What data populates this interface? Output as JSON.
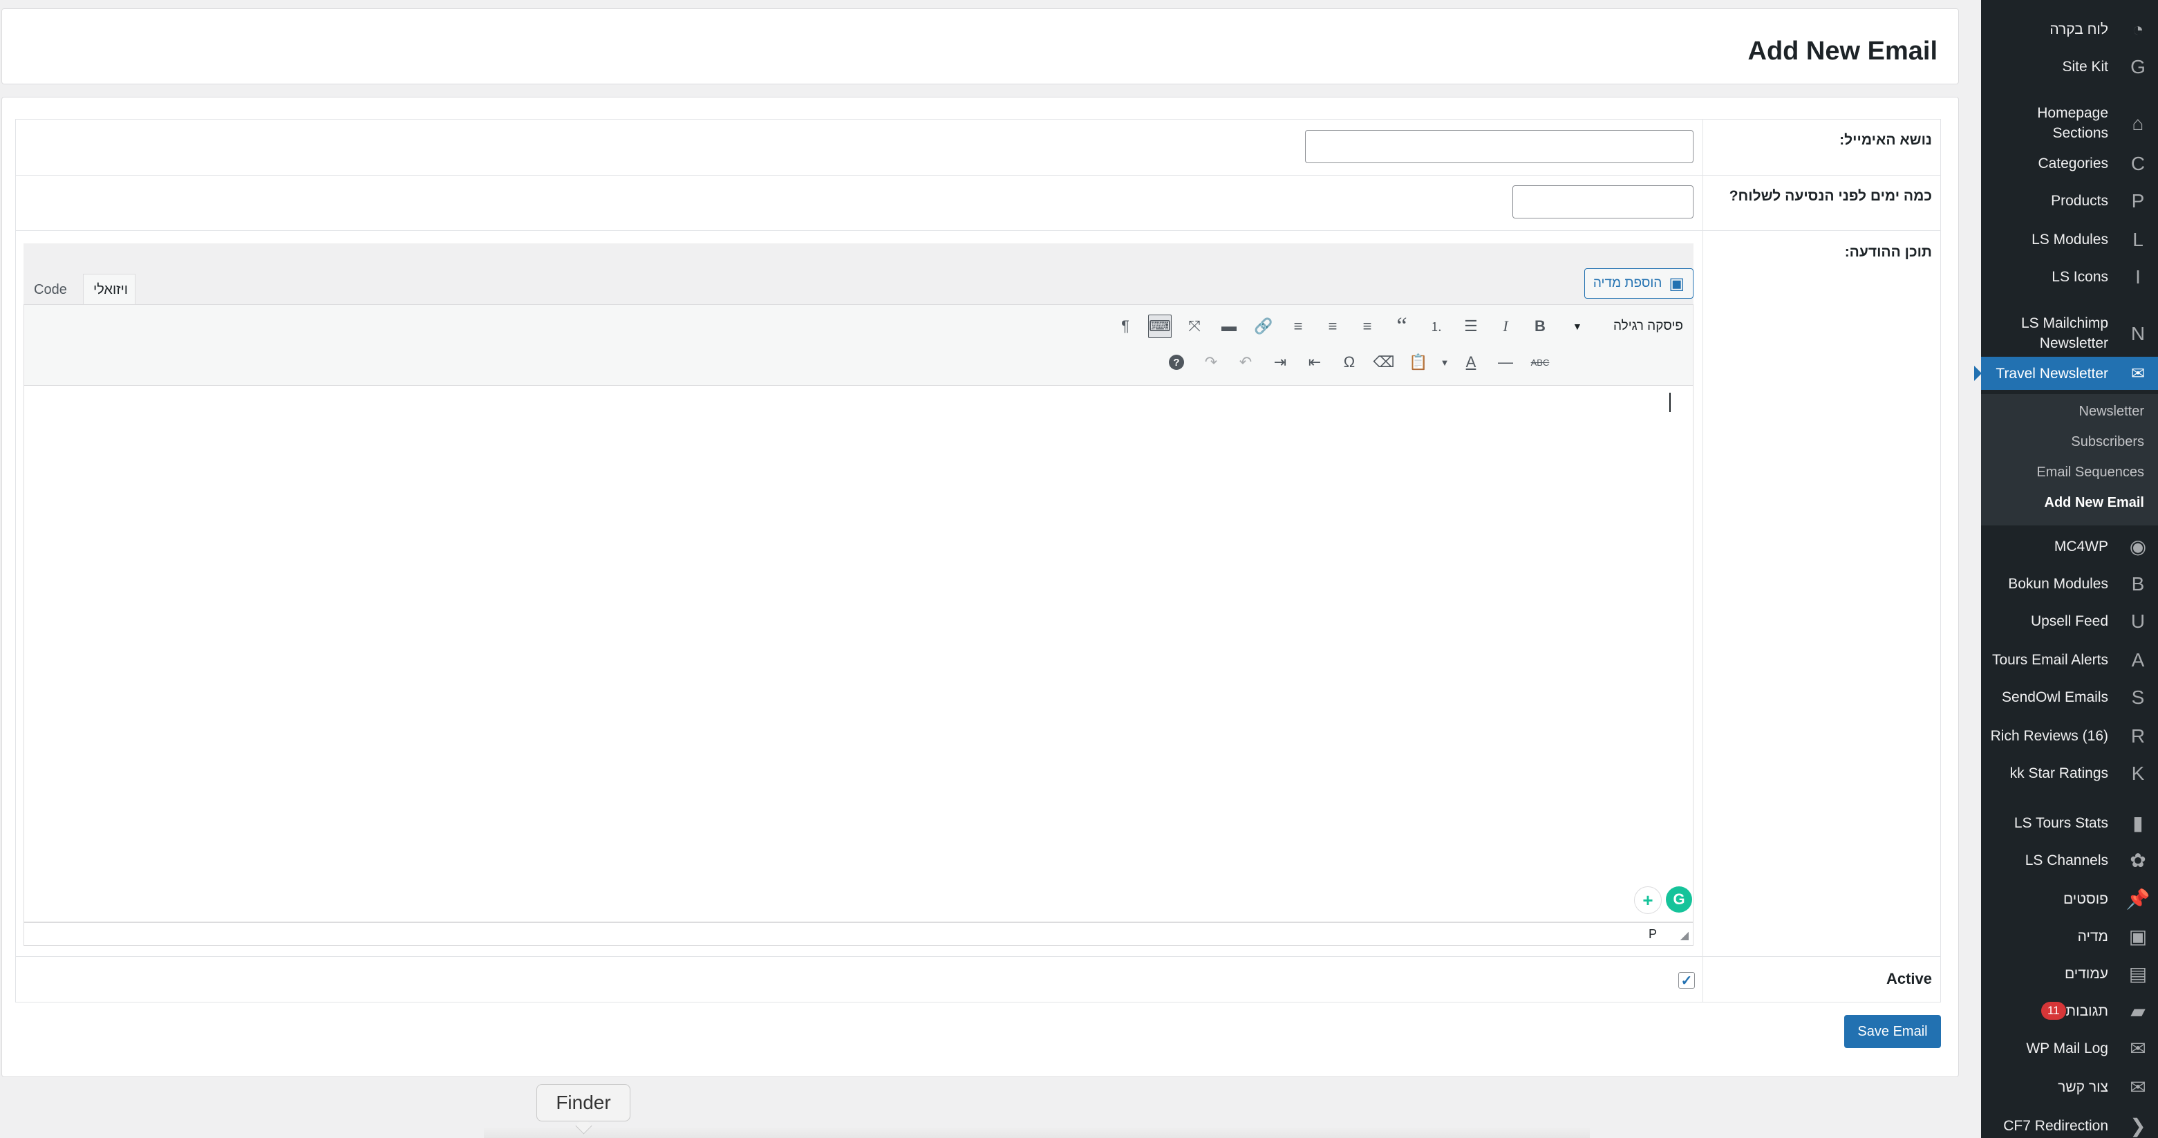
{
  "sidebar": {
    "items": [
      {
        "label": "לוח בקרה",
        "icon": "dashboard-icon",
        "glyph": "◔"
      },
      {
        "label": "Site Kit",
        "icon": "site-kit-icon",
        "glyph": "G"
      },
      {
        "label": "Homepage Sections",
        "icon": "home-icon",
        "glyph": "⌂"
      },
      {
        "label": "Categories",
        "icon": "categories-icon",
        "glyph": "C"
      },
      {
        "label": "Products",
        "icon": "products-icon",
        "glyph": "P"
      },
      {
        "label": "LS Modules",
        "icon": "ls-modules-icon",
        "glyph": "L"
      },
      {
        "label": "LS Icons",
        "icon": "ls-icons-icon",
        "glyph": "I"
      },
      {
        "label": "LS Mailchimp Newsletter",
        "icon": "ls-mailchimp-icon",
        "glyph": "N"
      },
      {
        "label": "Travel Newsletter",
        "icon": "envelope-icon",
        "glyph": "✉"
      },
      {
        "label": "MC4WP",
        "icon": "mc4wp-icon",
        "glyph": "◉"
      },
      {
        "label": "Bokun Modules",
        "icon": "bokun-icon",
        "glyph": "B"
      },
      {
        "label": "Upsell Feed",
        "icon": "upsell-icon",
        "glyph": "U"
      },
      {
        "label": "Tours Email Alerts",
        "icon": "tours-alerts-icon",
        "glyph": "A"
      },
      {
        "label": "SendOwl Emails",
        "icon": "sendowl-icon",
        "glyph": "S"
      },
      {
        "label": "Rich Reviews (16)",
        "icon": "rich-reviews-icon",
        "glyph": "R"
      },
      {
        "label": "kk Star Ratings",
        "icon": "star-ratings-icon",
        "glyph": "K"
      },
      {
        "label": "LS Tours Stats",
        "icon": "bar-chart-icon",
        "glyph": "▮"
      },
      {
        "label": "LS Channels",
        "icon": "channels-icon",
        "glyph": "✿"
      },
      {
        "label": "פוסטים",
        "icon": "pin-icon",
        "glyph": "📌"
      },
      {
        "label": "מדיה",
        "icon": "media-icon",
        "glyph": "▣"
      },
      {
        "label": "עמודים",
        "icon": "pages-icon",
        "glyph": "▤"
      },
      {
        "label": "תגובות",
        "icon": "comments-icon",
        "glyph": "▰",
        "badge": "11"
      },
      {
        "label": "WP Mail Log",
        "icon": "mail-log-icon",
        "glyph": "✉"
      },
      {
        "label": "צור קשר",
        "icon": "contact-icon",
        "glyph": "✉"
      },
      {
        "label": "CF7 Redirection",
        "icon": "cf7-redirection-icon",
        "glyph": "❯"
      }
    ],
    "submenu": [
      "Newsletter",
      "Subscribers",
      "Email Sequences",
      "Add New Email"
    ]
  },
  "page": {
    "title": "Add New Email"
  },
  "form": {
    "subject_label": "נושא האימייל:",
    "subject_value": "",
    "days_label": "כמה ימים לפני הנסיעה לשלוח?",
    "days_value": "",
    "content_label": "תוכן ההודעה:",
    "active_label": "Active",
    "active_checked": true,
    "save_label": "Save Email"
  },
  "editor": {
    "add_media": "הוספת מדיה",
    "tab_visual": "ויזואלי",
    "tab_code": "Code",
    "format_value": "פיסקה רגילה",
    "path": "P"
  },
  "dock": {
    "tooltip": "Finder"
  },
  "colors": {
    "accent": "#2271b1",
    "sidebar_bg": "#1d2327",
    "badge": "#d63638",
    "grammarly": "#15c39a"
  }
}
